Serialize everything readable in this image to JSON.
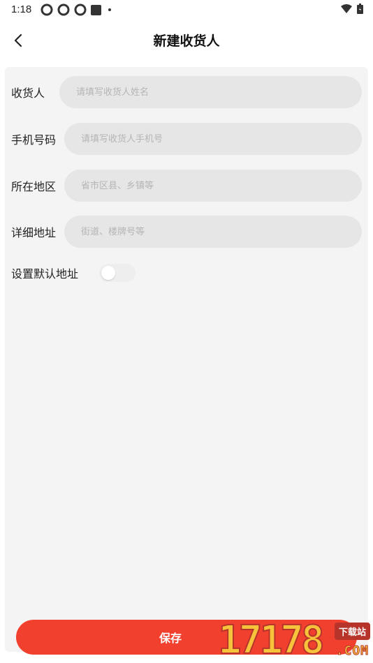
{
  "status_bar": {
    "time": "1:18",
    "left_icons": [
      "notification-icon",
      "notification-icon",
      "notification-icon",
      "stop-icon",
      "dot-icon"
    ],
    "right_icons": [
      "wifi-icon",
      "battery-icon"
    ]
  },
  "header": {
    "title": "新建收货人",
    "back_icon": "back-arrow-icon"
  },
  "form": {
    "name": {
      "label": "收货人",
      "placeholder": "请填写收货人姓名",
      "value": ""
    },
    "phone": {
      "label": "手机号码",
      "placeholder": "请填写收货人手机号",
      "value": ""
    },
    "region": {
      "label": "所在地区",
      "placeholder": "省市区县、乡镇等",
      "value": ""
    },
    "address": {
      "label": "详细地址",
      "placeholder": "街道、楼牌号等",
      "value": ""
    },
    "default_address": {
      "label": "设置默认地址",
      "enabled": false
    }
  },
  "footer": {
    "save_label": "保存"
  },
  "watermark": {
    "digits": "17178",
    "badge": "下载站",
    "domain": ".COM"
  },
  "colors": {
    "accent": "#f2402f",
    "card_bg": "#f4f4f4",
    "input_bg": "#e6e6e6",
    "placeholder": "#b5b5b5"
  }
}
